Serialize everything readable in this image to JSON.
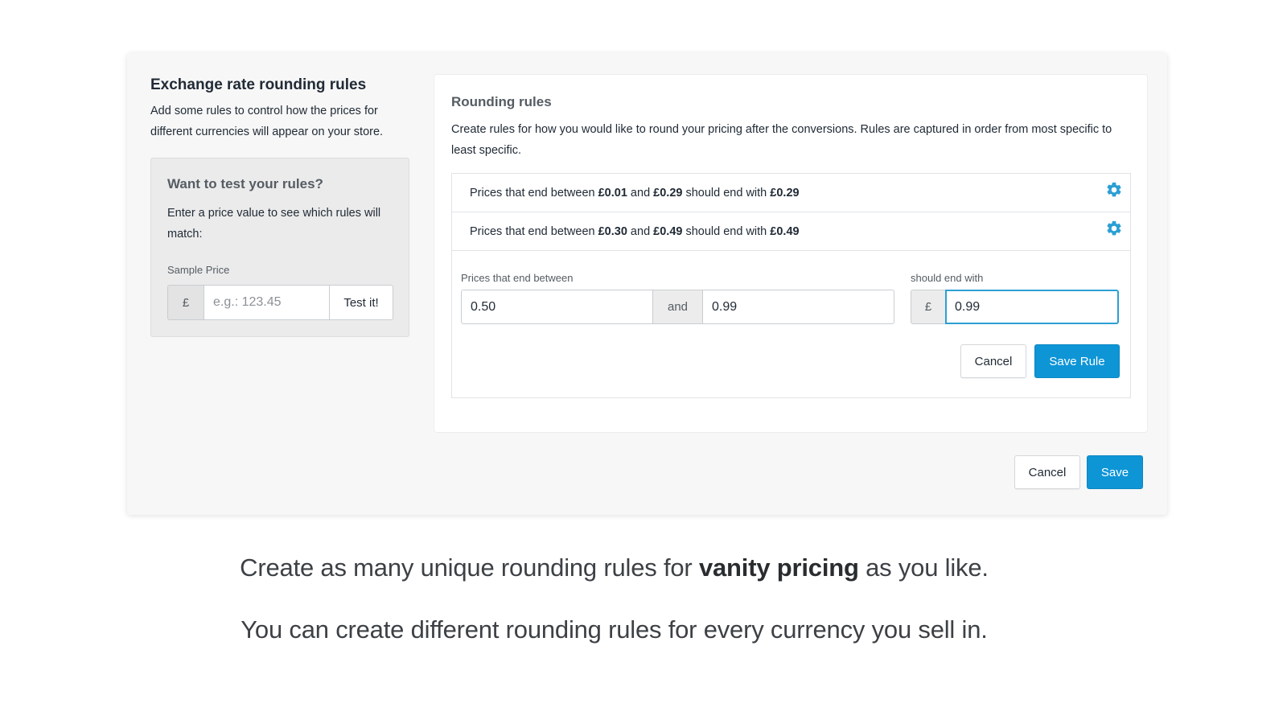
{
  "left": {
    "title": "Exchange rate rounding rules",
    "description": "Add some rules to control how the prices for different currencies will appear on your store.",
    "test_box": {
      "title": "Want to test your rules?",
      "description": "Enter a price value to see which rules will match:",
      "sample_label": "Sample Price",
      "currency_symbol": "£",
      "sample_placeholder": "e.g.: 123.45",
      "test_button": "Test it!"
    }
  },
  "right": {
    "title": "Rounding rules",
    "description": "Create rules for how you would like to round your pricing after the conversions. Rules are captured in order from most specific to least specific.",
    "rules": [
      {
        "prefix": "Prices that end between ",
        "from": "£0.01",
        "and": " and ",
        "to": "£0.29",
        "middle": " should end with ",
        "end": "£0.29"
      },
      {
        "prefix": "Prices that end between ",
        "from": "£0.30",
        "and": " and ",
        "to": "£0.49",
        "middle": " should end with ",
        "end": "£0.49"
      }
    ],
    "form": {
      "between_label": "Prices that end between",
      "from_value": "0.50",
      "and_label": "and",
      "to_value": "0.99",
      "end_label": "should end with",
      "currency_symbol": "£",
      "end_value": "0.99",
      "cancel_button": "Cancel",
      "save_rule_button": "Save Rule"
    }
  },
  "footer": {
    "cancel_button": "Cancel",
    "save_button": "Save"
  },
  "captions": {
    "line1_before": "Create as many unique rounding rules for ",
    "line1_bold": "vanity pricing",
    "line1_after": " as you like.",
    "line2": "You can create different rounding rules for every currency you sell in."
  },
  "colors": {
    "accent": "#0e95d6",
    "gear": "#2b9fd4"
  }
}
